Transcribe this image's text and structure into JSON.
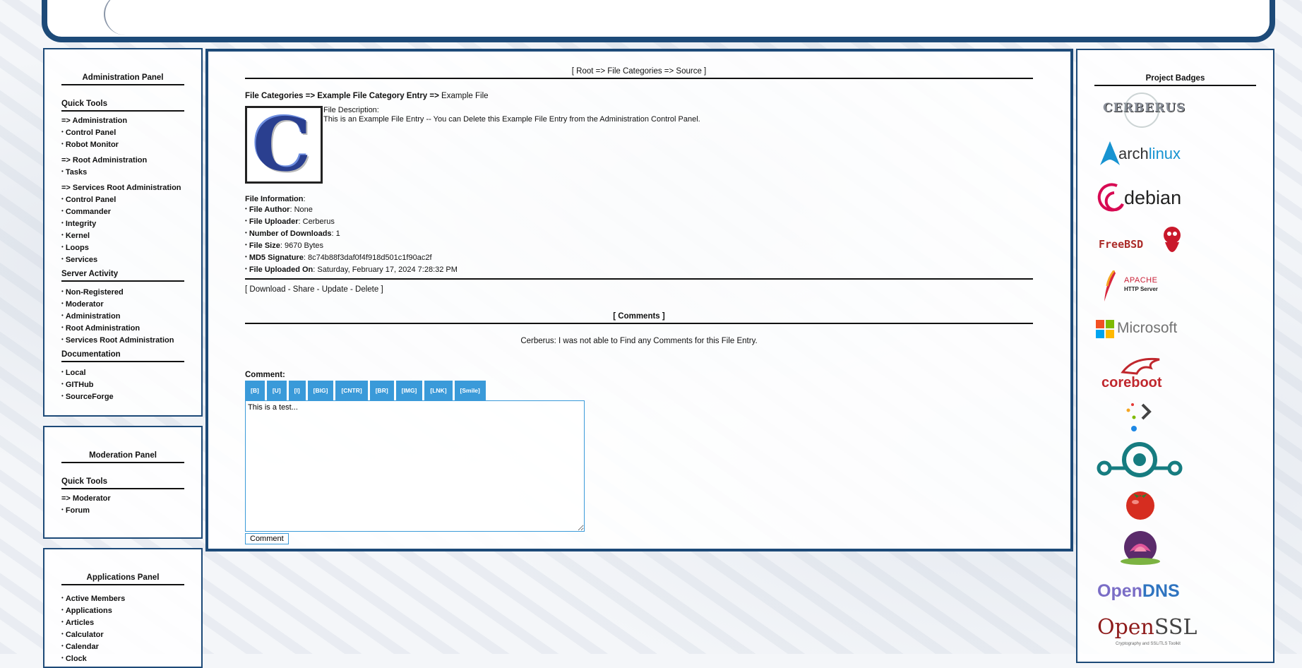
{
  "left_admin": {
    "title": "Administration Panel",
    "quick_tools": "Quick Tools",
    "group1": [
      "=> Administration",
      "Control Panel",
      "Robot Monitor"
    ],
    "group2": [
      "=> Root Administration",
      "Tasks"
    ],
    "group3": [
      "=> Services Root Administration",
      "Control Panel",
      "Commander",
      "Integrity",
      "Kernel",
      "Loops",
      "Services"
    ],
    "server_activity": "Server Activity",
    "server_items": [
      "Non-Registered",
      "Moderator",
      "Administration",
      "Root Administration",
      "Services Root Administration"
    ],
    "documentation": "Documentation",
    "doc_items": [
      "Local",
      "GITHub",
      "SourceForge"
    ]
  },
  "left_mod": {
    "title": "Moderation Panel",
    "quick_tools": "Quick Tools",
    "items": [
      "=> Moderator",
      "Forum"
    ]
  },
  "left_apps": {
    "title": "Applications Panel",
    "items": [
      "Active Members",
      "Applications",
      "Articles",
      "Calculator",
      "Calendar",
      "Clock"
    ]
  },
  "main": {
    "top_crumb": "[ Root => File Categories => Source ]",
    "path_bold": "File Categories => Example File Category Entry =>",
    "path_tail": "Example File",
    "desc_label": "File Description:",
    "desc_text": "This is an Example File Entry -- You can Delete this Example File Entry from the Administration Control Panel.",
    "info_title": "File Information",
    "info_items": [
      {
        "label": "File Author",
        "value": "None"
      },
      {
        "label": "File Uploader",
        "value": "Cerberus"
      },
      {
        "label": "Number of Downloads",
        "value": "1"
      },
      {
        "label": "File Size",
        "value": "9670 Bytes"
      },
      {
        "label": "MD5 Signature",
        "value": "8c74b88f3daf0f4f918d501c1f90ac2f"
      },
      {
        "label": "File Uploaded On",
        "value": "Saturday, February 17, 2024 7:28:32 PM"
      }
    ],
    "actions": {
      "open": "[ ",
      "download": "Download",
      "share": "Share",
      "update": "Update",
      "delete": "Delete",
      "sep": " - ",
      "close": " ]"
    },
    "comments_heading": "[ Comments ]",
    "no_comments": "Cerberus: I was not able to Find any Comments for this File Entry.",
    "comment_label": "Comment:",
    "toolbar": [
      "[B]",
      "[U]",
      "[I]",
      "[BIG]",
      "[CNTR]",
      "[BR]",
      "[IMG]",
      "[LNK]",
      "[Smile]"
    ],
    "comment_value": "This is a test...",
    "submit_label": "Comment"
  },
  "badges": {
    "title": "Project Badges",
    "cerberus": "CERBERUS",
    "arch": "arch",
    "arch2": "linux",
    "debian": "debian",
    "freebsd": "FreeBSD",
    "apache1": "APACHE",
    "apache2": "HTTP Server",
    "microsoft": "Microsoft",
    "coreboot": "coreboot",
    "opendns1": "Open",
    "opendns2": "DNS",
    "openssl1": "Open",
    "openssl2": "SSL",
    "openssl3": "Cryptography and SSL/TLS Toolkit"
  }
}
